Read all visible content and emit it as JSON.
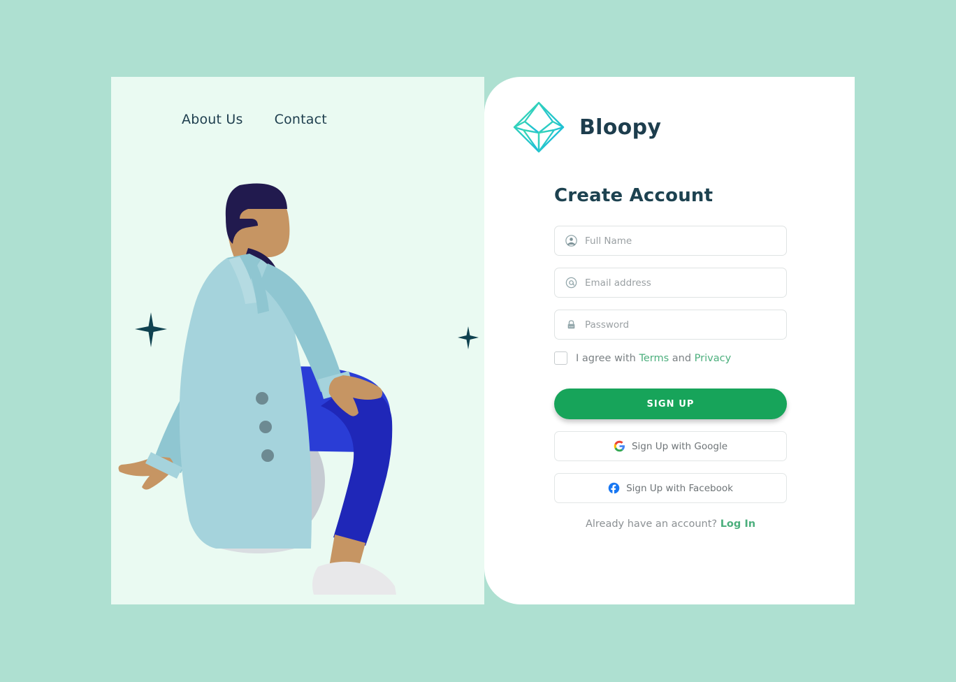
{
  "colors": {
    "page_bg": "#aee0d1",
    "left_panel_bg": "#eafaf2",
    "right_panel_bg": "#ffffff",
    "primary_green": "#17a45a",
    "link_green": "#4caf7d",
    "heading": "#1d4250",
    "logo_gradient_start": "#3ad9b0",
    "logo_gradient_end": "#17b8e0"
  },
  "nav": {
    "items": [
      {
        "label": "About Us",
        "name": "nav-link-about-us"
      },
      {
        "label": "Contact",
        "name": "nav-link-contact"
      }
    ]
  },
  "brand": {
    "name": "Bloopy",
    "logo_icon": "diamond-gem-icon"
  },
  "form": {
    "title": "Create Account",
    "fields": [
      {
        "icon": "person-icon",
        "placeholder": "Full Name",
        "value": "",
        "type": "text"
      },
      {
        "icon": "at-sign-icon",
        "placeholder": "Email address",
        "value": "",
        "type": "email"
      },
      {
        "icon": "lock-icon",
        "placeholder": "Password",
        "value": "",
        "type": "password"
      }
    ],
    "agreement": {
      "checked": false,
      "prefix": "I agree with",
      "terms_label": "Terms",
      "conjunction": "and",
      "privacy_label": "Privacy"
    },
    "submit_label": "SIGN UP",
    "social_buttons": [
      {
        "label": "Sign Up with Google",
        "icon": "google-icon"
      },
      {
        "label": "Sign Up with Facebook",
        "icon": "facebook-icon"
      }
    ],
    "footer": {
      "prompt": "Already have an account?",
      "login_label": "Log In"
    }
  },
  "illustration": {
    "alt": "person-sitting-on-exercise-ball-illustration",
    "colors": {
      "coat": "#a5d3dc",
      "coat_shade": "#8fc6d1",
      "shirt": "#211a4e",
      "hair": "#211a4e",
      "skin": "#c69563",
      "pants": "#2a3dd6",
      "pants_dark": "#1f27b8",
      "ball": "#c6cbd2",
      "shoe": "#e8e8ea",
      "button": "#6d8a92",
      "sparkle": "#0f4250"
    }
  }
}
